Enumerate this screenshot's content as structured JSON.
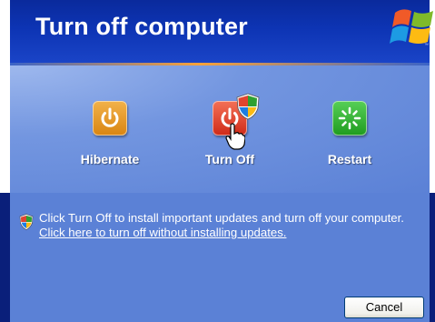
{
  "dialog": {
    "title": "Turn off computer",
    "logo": "windows-xp-logo",
    "options": [
      {
        "label": "Hibernate",
        "icon": "power-icon",
        "color": "#e09525"
      },
      {
        "label": "Turn Off",
        "icon": "power-icon",
        "color": "#e0452f"
      },
      {
        "label": "Restart",
        "icon": "restart-icon",
        "color": "#2fb02f"
      }
    ],
    "notice": {
      "text": "Click Turn Off to install important updates and turn off your computer.",
      "link": "Click here to turn off without installing updates."
    },
    "cancel_label": "Cancel"
  },
  "colors": {
    "header": "#0d34b4",
    "panel": "#6a8ddd",
    "accent": "#f8a23a"
  }
}
